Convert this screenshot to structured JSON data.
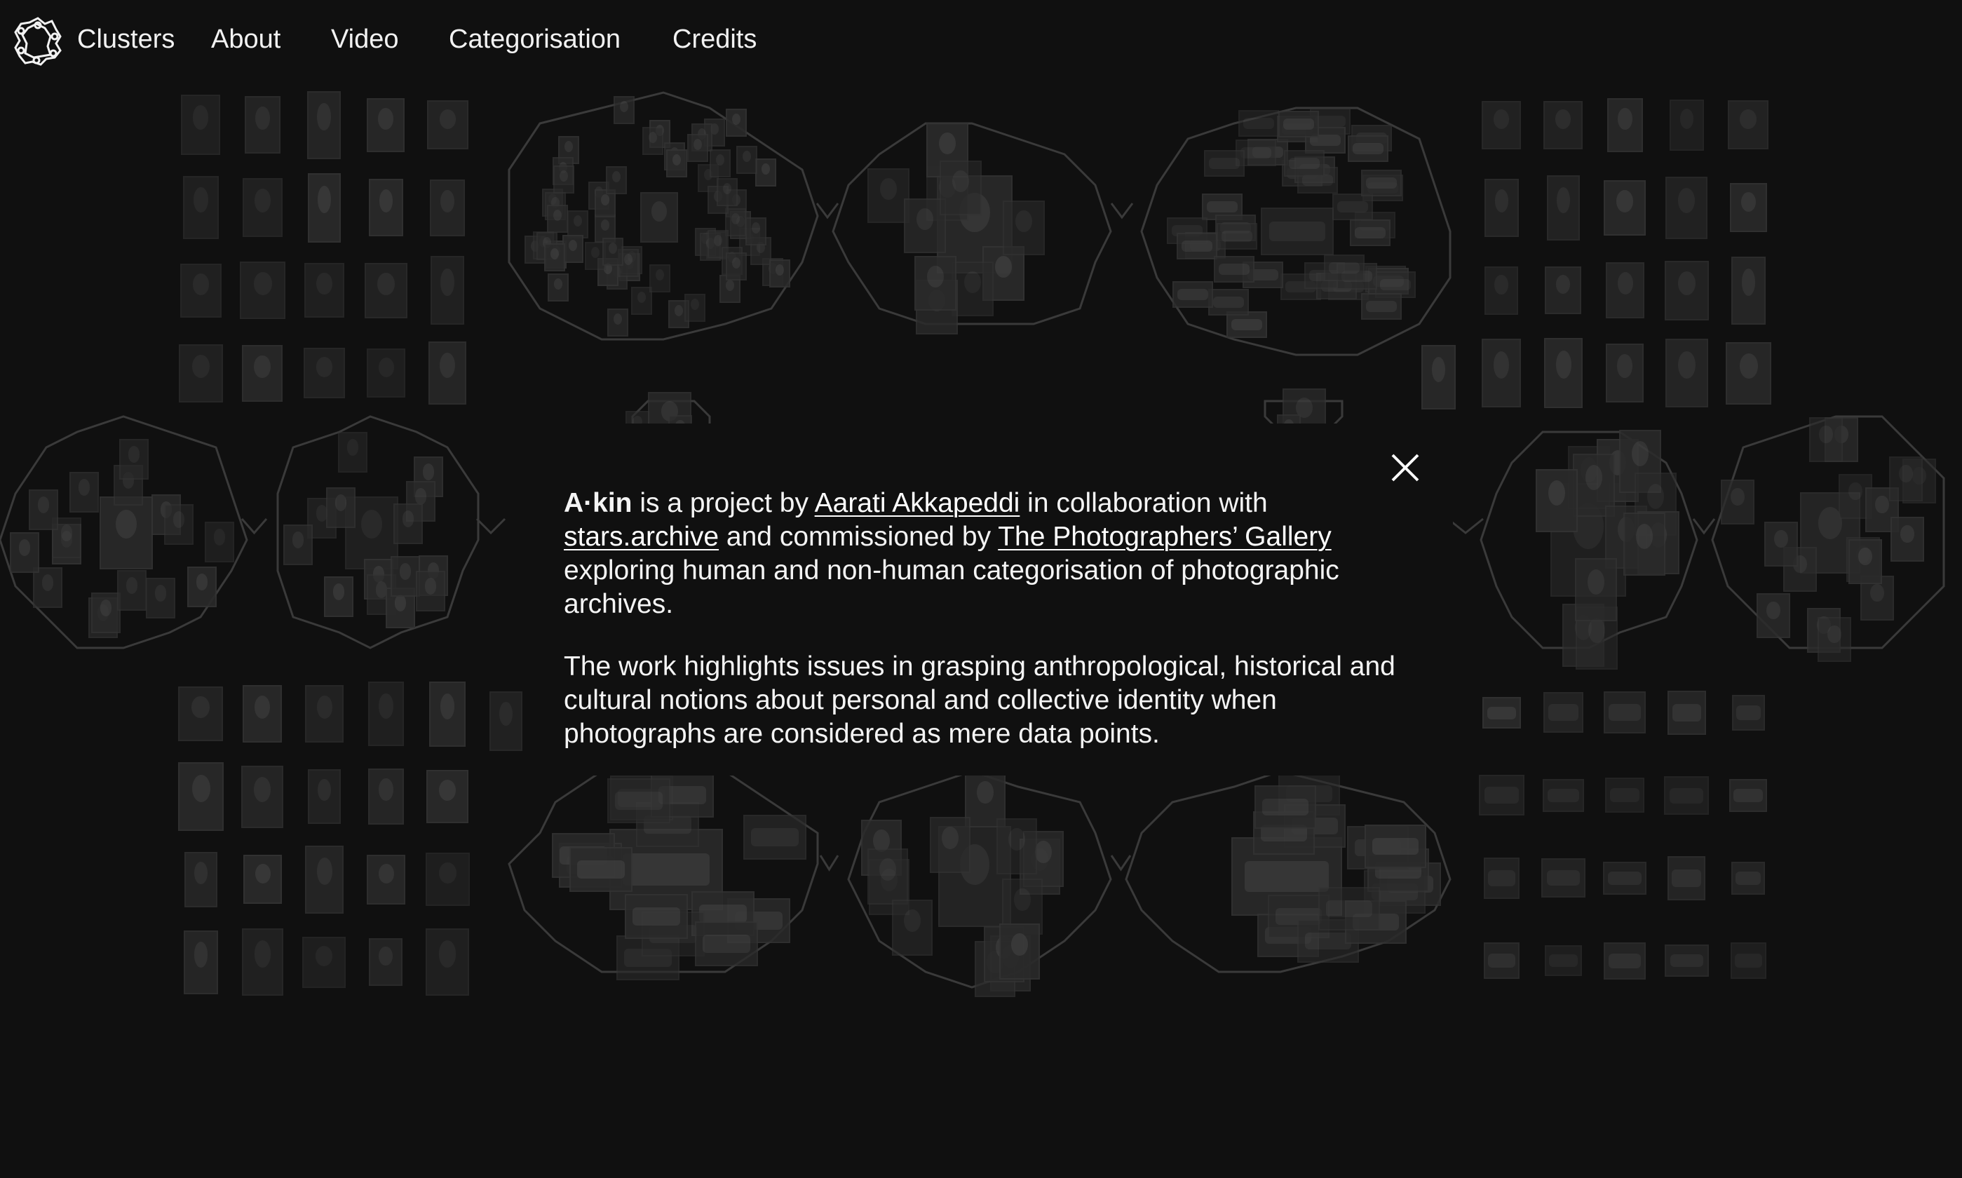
{
  "nav": {
    "logo_icon": "akin-knot-logo-icon",
    "items": [
      {
        "label": "Clusters"
      },
      {
        "label": "About"
      },
      {
        "label": "Video"
      },
      {
        "label": "Categorisation"
      },
      {
        "label": "Credits"
      }
    ]
  },
  "about_modal": {
    "close_icon": "close-icon",
    "paragraph1": {
      "project_name": "A·kin",
      "text1": " is a project by ",
      "author_link": "Aarati Akkapeddi",
      "text2": " in collaboration with ",
      "collab_link": "stars.archive",
      "text3": " and commissioned by ",
      "commissioner_link": "The Photographers’ Gallery",
      "text4": " exploring human and non-human categorisation of photographic archives."
    },
    "paragraph2": "The work highlights issues in grasping anthropological, historical and cultural notions about personal and collective identity when photographs are considered as mere data points."
  },
  "colors": {
    "background": "#101010",
    "text": "#ffffff",
    "cluster_outline": "#3a3a3a",
    "thumbnail": "#2a2a2a"
  }
}
